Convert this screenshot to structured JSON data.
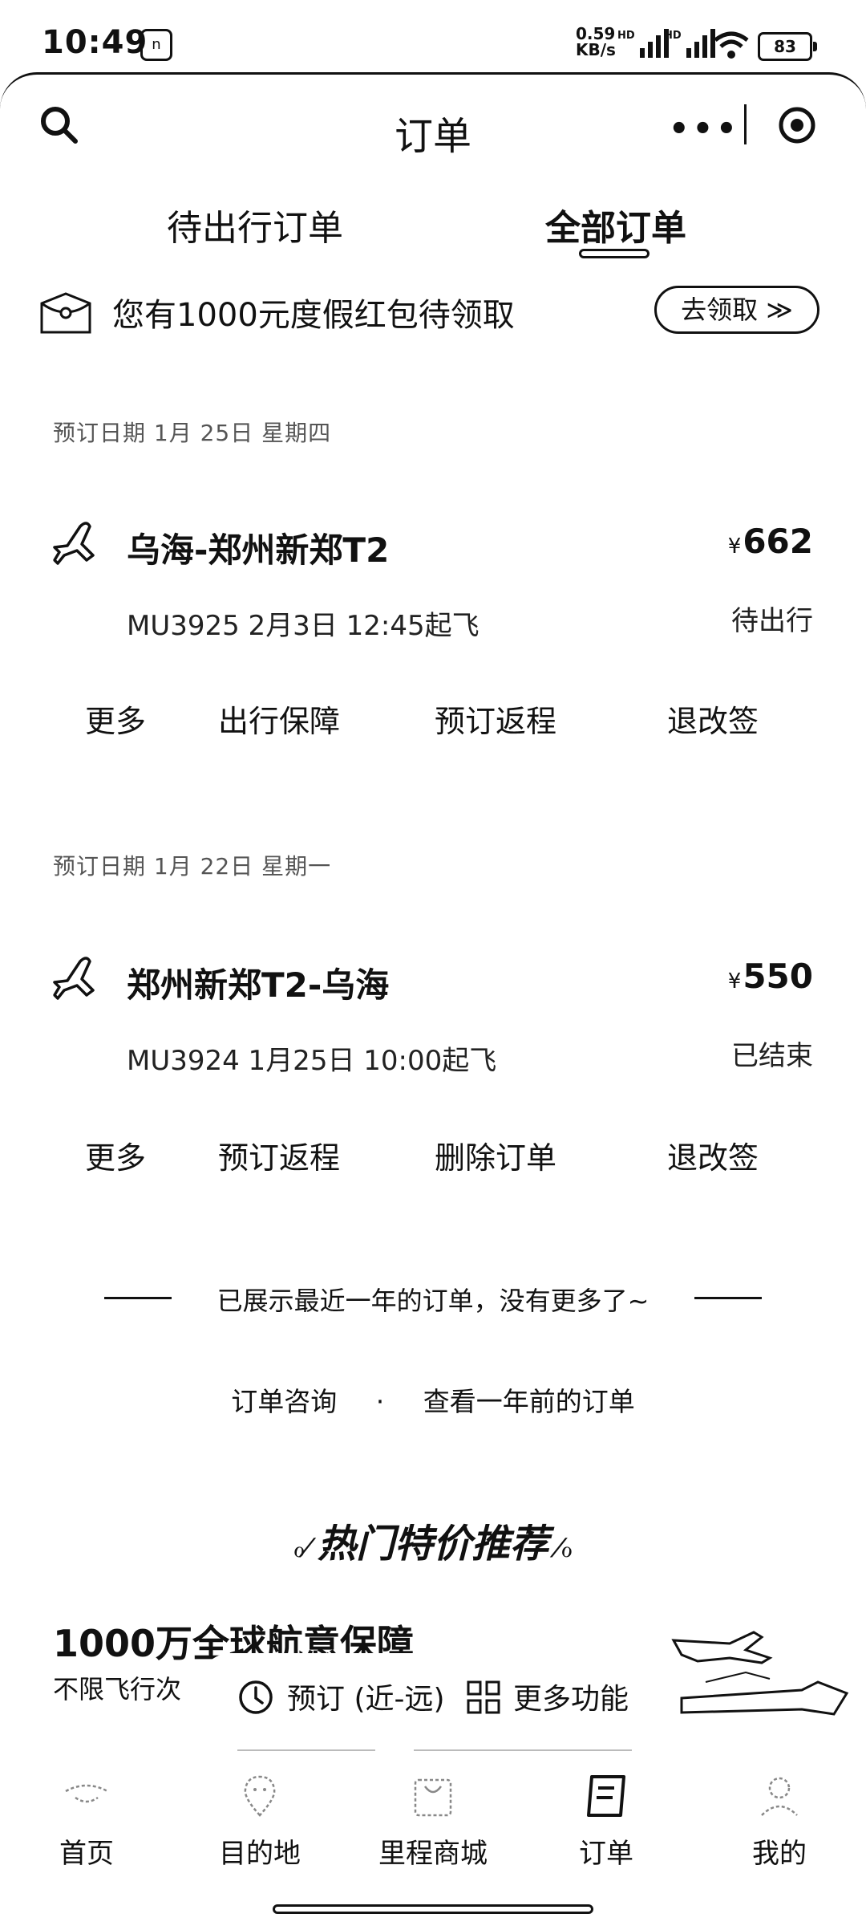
{
  "status_bar": {
    "time": "10:49",
    "notif_badge": "n",
    "net_speed_top": "0.59",
    "net_speed_bottom": "KB/s",
    "battery": "83"
  },
  "header": {
    "title": "订单"
  },
  "tabs": [
    {
      "label": "待出行订单"
    },
    {
      "label": "全部订单"
    }
  ],
  "promo": {
    "text": "您有1000元度假红包待领取",
    "button": "去领取 ≫"
  },
  "orders": [
    {
      "date": "预订日期 1月 25日 星期四",
      "route": "乌海-郑州新郑T2",
      "currency": "¥",
      "price": "662",
      "flight": "MU3925   2月3日 12:45起飞",
      "status": "待出行",
      "actions": [
        "更多",
        "出行保障",
        "预订返程",
        "退改签"
      ]
    },
    {
      "date": "预订日期 1月 22日 星期一",
      "route": "郑州新郑T2-乌海",
      "currency": "¥",
      "price": "550",
      "flight": "MU3924   1月25日 10:00起飞",
      "status": "已结束",
      "actions": [
        "更多",
        "预订返程",
        "删除订单",
        "退改签"
      ]
    }
  ],
  "end_note": "已展示最近一年的订单，没有更多了~",
  "links": {
    "consult": "订单咨询",
    "sep": "·",
    "older": "查看一年前的订单"
  },
  "hot": {
    "title": "热门特价推荐"
  },
  "insurance": {
    "title": "1000万全球航意保障",
    "subtitle": "不限飞行次"
  },
  "floating_bar": {
    "book": "预订 (近-远)",
    "more": "更多功能"
  },
  "tabbar": [
    {
      "label": "首页",
      "icon": "home-icon"
    },
    {
      "label": "目的地",
      "icon": "location-icon"
    },
    {
      "label": "里程商城",
      "icon": "shop-icon"
    },
    {
      "label": "订单",
      "icon": "order-icon"
    },
    {
      "label": "我的",
      "icon": "profile-icon"
    }
  ]
}
